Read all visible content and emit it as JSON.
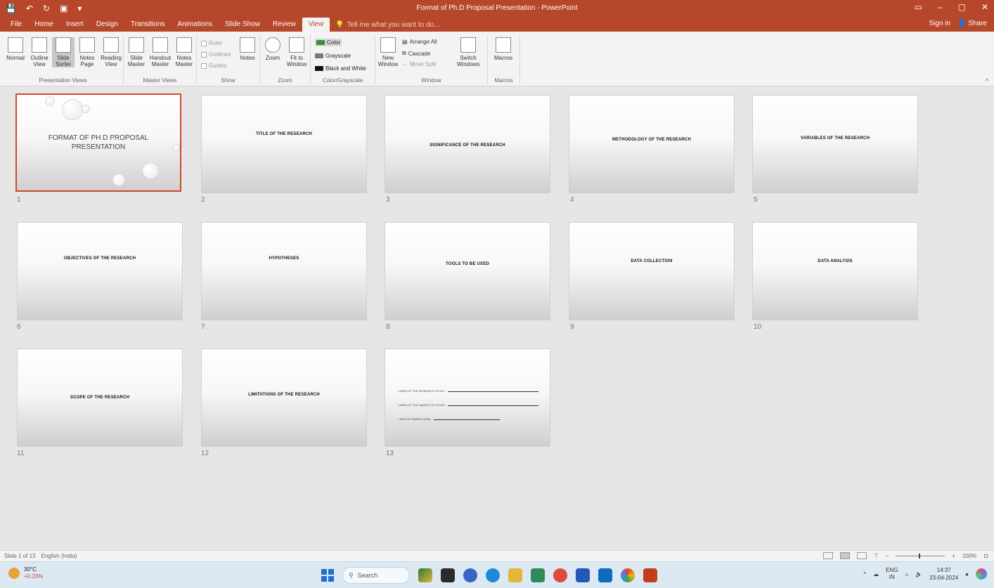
{
  "window": {
    "title": "Format of Ph.D Proposal Presentation - PowerPoint",
    "quick_access": [
      "💾",
      "↶",
      "↻",
      "▣",
      "▾"
    ],
    "controls": {
      "options": "▭",
      "minimize": "–",
      "maximize": "▢",
      "close": "✕"
    }
  },
  "tabs": {
    "items": [
      "File",
      "Home",
      "Insert",
      "Design",
      "Transitions",
      "Animations",
      "Slide Show",
      "Review",
      "View"
    ],
    "active": "View",
    "tell_me": "Tell me what you want to do...",
    "sign_in": "Sign in",
    "share": "Share"
  },
  "ribbon": {
    "groups": {
      "presentation_views": "Presentation Views",
      "master_views": "Master Views",
      "show": "Show",
      "zoom": "Zoom",
      "color_grayscale": "Color/Grayscale",
      "window": "Window",
      "macros": "Macros"
    },
    "buttons": {
      "normal": "Normal",
      "outline_view": "Outline View",
      "slide_sorter": "Slide Sorter",
      "notes_page": "Notes Page",
      "reading_view": "Reading View",
      "slide_master": "Slide Master",
      "handout_master": "Handout Master",
      "notes_master": "Notes Master",
      "notes": "Notes",
      "zoom": "Zoom",
      "fit_to_window": "Fit to Window",
      "new_window": "New Window",
      "switch_windows": "Switch Windows",
      "macros": "Macros"
    },
    "show_options": [
      "Ruler",
      "Gridlines",
      "Guides"
    ],
    "color_options": [
      "Color",
      "Grayscale",
      "Black and White"
    ],
    "window_options": [
      "Arrange All",
      "Cascade",
      "Move Split"
    ],
    "colors": {
      "accent": "#b7472a",
      "selection": "#d24726"
    }
  },
  "slides": [
    {
      "number": "1",
      "title": "FORMAT OF PH.D PROPOSAL PRESENTATION",
      "selected": true
    },
    {
      "number": "2",
      "title": "TITLE OF THE RESEARCH"
    },
    {
      "number": "3",
      "title": "SIGNIFICANCE OF THE RESEARCH"
    },
    {
      "number": "4",
      "title": "METHODOLOGY OF THE RESEARCH"
    },
    {
      "number": "5",
      "title": "VARIABLES OF THE RESEARCH"
    },
    {
      "number": "6",
      "title": "OBJECTIVES OF THE RESEARCH"
    },
    {
      "number": "7",
      "title": "HYPOTHESES"
    },
    {
      "number": "8",
      "title": "TOOLS TO BE USED"
    },
    {
      "number": "9",
      "title": "DATA COLLECTION"
    },
    {
      "number": "10",
      "title": "DATA ANALYSIS"
    },
    {
      "number": "11",
      "title": "SCOPE OF THE RESEARCH"
    },
    {
      "number": "12",
      "title": "LIMITATIONS OF THE RESEARCH"
    },
    {
      "number": "13",
      "lines": [
        "• AREA OF THE RESEARCH STUDY",
        "• AREA OF THE SAMPLE OF STUDY",
        "• SIZE OF SAMPLE DATA"
      ]
    }
  ],
  "status": {
    "slide_count": "Slide 1 of 13",
    "language": "English (India)",
    "zoom": "100%"
  },
  "taskbar": {
    "weather_temp": "30°C",
    "weather_change": "+0.23%",
    "search": "Search",
    "lang_top": "ENG",
    "lang_bottom": "IN",
    "time": "14:37",
    "date": "23-04-2024"
  }
}
